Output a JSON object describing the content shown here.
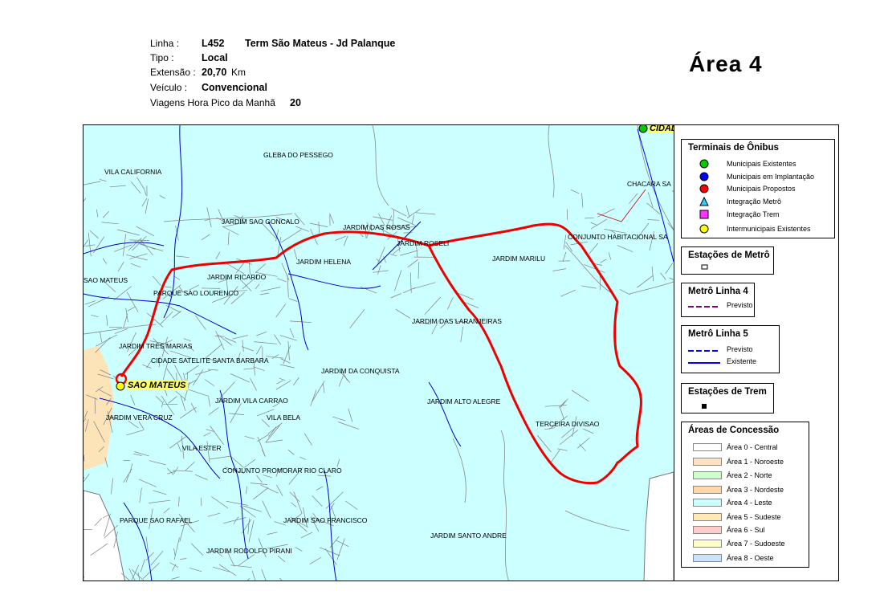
{
  "info": {
    "linha_label": "Linha :",
    "linha_code": "L452",
    "linha_name": "Term São Mateus - Jd Palanque",
    "tipo_label": "Tipo :",
    "tipo_value": "Local",
    "extensao_label": "Extensão :",
    "extensao_value": "20,70",
    "extensao_unit": "Km",
    "veiculo_label": "Veículo :",
    "veiculo_value": "Convencional",
    "viagens_label": "Viagens Hora Pico da Manhã",
    "viagens_value": "20"
  },
  "area_title": "Área  4",
  "map": {
    "terminal_label": "SAO MATEUS",
    "cut_label_top": "CIDAD",
    "places": [
      "GLEBA DO PESSEGO",
      "VILA CALIFORNIA",
      "CHACARA SA",
      "JARDIM SAO GONCALO",
      "JARDIM DAS ROSAS",
      "JARDIM ROSELI",
      "CONJUNTO HABITACIONAL SA",
      "JARDIM HELENA",
      "JARDIM MARILU",
      "SAO MATEUS",
      "JARDIM RICARDO",
      "PARQUE SAO LOURENCO",
      "JARDIM DAS LARANJEIRAS",
      "JARDIM TRES MARIAS",
      "CIDADE SATELITE SANTA BARBARA",
      "JARDIM DA CONQUISTA",
      "JARDIM VILA CARRAO",
      "JARDIM ALTO ALEGRE",
      "JARDIM VERA CRUZ",
      "VILA BELA",
      "TERCEIRA DIVISAO",
      "VILA ESTER",
      "CONJUNTO PROMORAR RIO CLARO",
      "PARQUE SAO RAFAEL",
      "JARDIM SAO FRANCISCO",
      "JARDIM SANTO ANDRE",
      "JARDIM RODOLFO PIRANI"
    ]
  },
  "legend": {
    "terminais": {
      "title": "Terminais de Ônibus",
      "items": [
        {
          "label": "Municipais Existentes",
          "symbol": "green-circle",
          "color": "#00cc00"
        },
        {
          "label": "Municipais em Implantação",
          "symbol": "blue-circle",
          "color": "#0000ff"
        },
        {
          "label": "Municipais Propostos",
          "symbol": "red-circle",
          "color": "#ff0000"
        },
        {
          "label": "Integração Metrô",
          "symbol": "cyan-triangle",
          "color": "#33ccff"
        },
        {
          "label": "Integração Trem",
          "symbol": "magenta-square",
          "color": "#ff33ff"
        },
        {
          "label": "Intermunicipais Existentes",
          "symbol": "yellow-circle",
          "color": "#ffff00"
        }
      ]
    },
    "estacoes_metro": {
      "title": "Estações de Metrô"
    },
    "metro_l4": {
      "title": "Metrô Linha 4",
      "items": [
        {
          "label": "Previsto",
          "color": "#800080"
        }
      ]
    },
    "metro_l5": {
      "title": "Metrô Linha 5",
      "items": [
        {
          "label": "Previsto",
          "color": "#0000ff"
        },
        {
          "label": "Existente",
          "color": "#0000ff"
        }
      ]
    },
    "estacoes_trem": {
      "title": "Estações de Trem"
    },
    "areas": {
      "title": "Áreas de Concessão",
      "items": [
        {
          "label": "Área 0 - Central",
          "color": "#ffffff"
        },
        {
          "label": "Área 1 - Noroeste",
          "color": "#ffe0c0"
        },
        {
          "label": "Área 2 - Norte",
          "color": "#ccffcc"
        },
        {
          "label": "Área 3 - Nordeste",
          "color": "#ffd8a8"
        },
        {
          "label": "Área 4 - Leste",
          "color": "#ccffff"
        },
        {
          "label": "Área 5 - Sudeste",
          "color": "#ffeab5"
        },
        {
          "label": "Área 6 - Sul",
          "color": "#ffcccc"
        },
        {
          "label": "Área 7 - Sudoeste",
          "color": "#ffffcc"
        },
        {
          "label": "Área 8 - Oeste",
          "color": "#cce0ff"
        }
      ]
    }
  },
  "colors": {
    "route": "#ee0000",
    "area4": "#ccffff",
    "area3": "#fce3b8",
    "streets": "#777777",
    "rivers": "#0000cc"
  }
}
